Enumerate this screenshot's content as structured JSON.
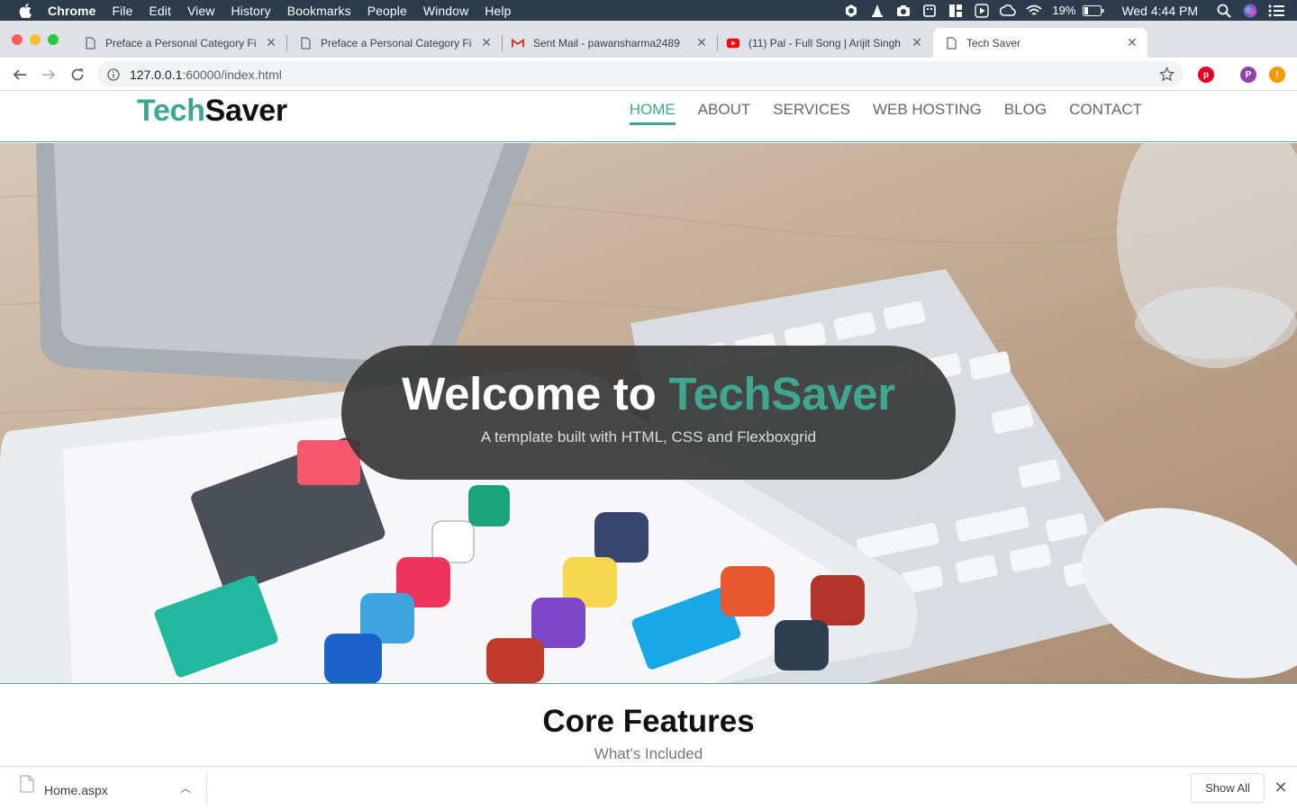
{
  "menubar": {
    "app": "Chrome",
    "items": [
      "File",
      "Edit",
      "View",
      "History",
      "Bookmarks",
      "People",
      "Window",
      "Help"
    ],
    "battery": "19%",
    "clock": "Wed 4:44 PM"
  },
  "tabs": [
    {
      "title": "Preface a Personal Category Fi",
      "icon": "page-icon"
    },
    {
      "title": "Preface a Personal Category Fi",
      "icon": "page-icon"
    },
    {
      "title": "Sent Mail - pawansharma2489",
      "icon": "gmail-icon"
    },
    {
      "title": "(11) Pal - Full Song | Arijit Singh",
      "icon": "youtube-icon"
    },
    {
      "title": "Tech Saver",
      "icon": "page-icon"
    }
  ],
  "address": {
    "host": "127.0.0.1",
    "path": ":60000/index.html"
  },
  "extensions": {
    "profile_initial": "P"
  },
  "site": {
    "logo_part1": "Tech",
    "logo_part2": "Saver",
    "nav": [
      "HOME",
      "ABOUT",
      "SERVICES",
      "WEB HOSTING",
      "BLOG",
      "CONTACT"
    ],
    "active_nav": "HOME"
  },
  "hero": {
    "welcome_prefix": "Welcome to",
    "brand": "TechSaver",
    "tagline": "A template built with HTML, CSS and Flexboxgrid"
  },
  "features": {
    "title": "Core Features",
    "subtitle": "What's Included"
  },
  "downloads": {
    "file_name": "Home.aspx",
    "show_all": "Show All"
  },
  "colors": {
    "accent": "#3ea691",
    "menubar": "#2d3c4c"
  }
}
